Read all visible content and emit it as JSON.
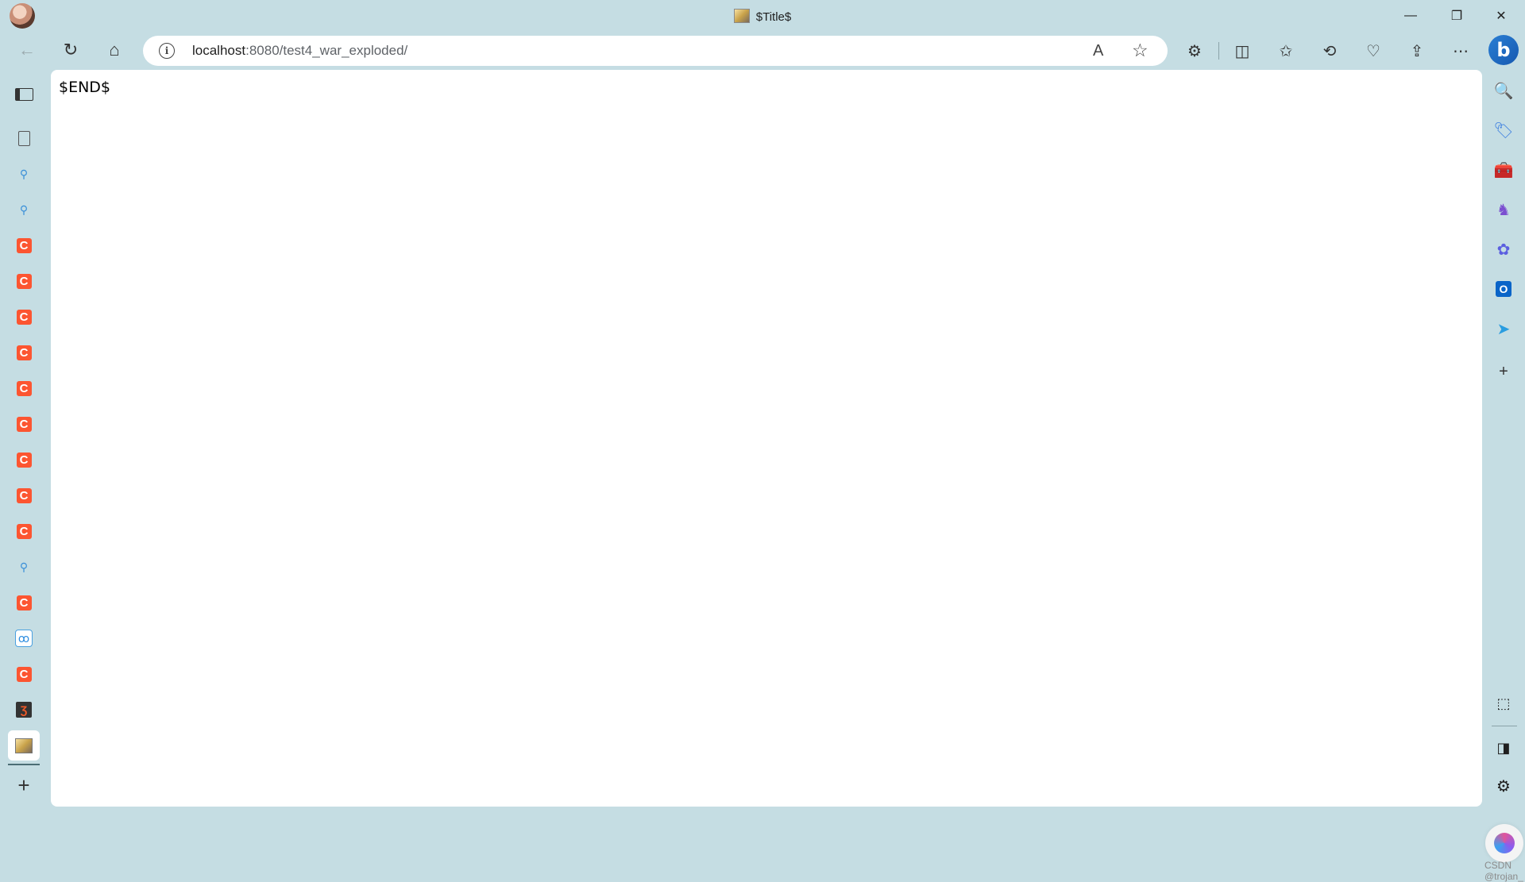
{
  "window": {
    "title": "$Title$",
    "controls": {
      "minimize": "—",
      "restore": "❐",
      "close": "✕"
    }
  },
  "toolbar": {
    "back_icon": "←",
    "reload_icon": "↻",
    "home_icon": "⌂",
    "address": {
      "host": "localhost",
      "rest": ":8080/test4_war_exploded/"
    },
    "read_aloud_icon": "A",
    "favorite_icon": "☆",
    "extensions_icon": "⚙",
    "split_icon": "◫",
    "favorites_icon": "✩",
    "history_icon": "⟲",
    "performance_icon": "♡",
    "share_icon": "⇪",
    "more_icon": "⋯",
    "copilot_label": "b"
  },
  "left_tabs": {
    "new_tab_icon": "+",
    "items": [
      {
        "type": "doc",
        "glyph": ""
      },
      {
        "type": "search",
        "glyph": "⚲"
      },
      {
        "type": "search",
        "glyph": "⚲"
      },
      {
        "type": "csdn",
        "glyph": "C"
      },
      {
        "type": "csdn",
        "glyph": "C"
      },
      {
        "type": "csdn",
        "glyph": "C"
      },
      {
        "type": "csdn",
        "glyph": "C"
      },
      {
        "type": "csdn",
        "glyph": "C"
      },
      {
        "type": "csdn",
        "glyph": "C"
      },
      {
        "type": "csdn",
        "glyph": "C"
      },
      {
        "type": "csdn",
        "glyph": "C"
      },
      {
        "type": "csdn",
        "glyph": "C"
      },
      {
        "type": "search",
        "glyph": "⚲"
      },
      {
        "type": "csdn",
        "glyph": "C"
      },
      {
        "type": "cloud",
        "glyph": "ꝏ"
      },
      {
        "type": "csdn",
        "glyph": "C"
      },
      {
        "type": "rnote",
        "glyph": "Ʒ"
      },
      {
        "type": "image",
        "glyph": ""
      }
    ]
  },
  "page": {
    "body_text": "$END$",
    "watermark": "CSDN @trojan_"
  },
  "right_sidebar": {
    "items": [
      {
        "name": "search-icon",
        "glyph": "🔍",
        "color": "#2f6fd6"
      },
      {
        "name": "shopping-tag-icon",
        "glyph": "🏷",
        "color": "#3a7de0"
      },
      {
        "name": "tools-icon",
        "glyph": "🧰",
        "color": "#d9532b"
      },
      {
        "name": "games-icon",
        "glyph": "♞",
        "color": "#7b4fd0"
      },
      {
        "name": "copilot-apps-icon",
        "glyph": "✿",
        "color": "#5b5fe0"
      },
      {
        "name": "outlook-icon",
        "glyph": "O",
        "color": "#0a64c8"
      },
      {
        "name": "send-icon",
        "glyph": "➤",
        "color": "#2a9de0"
      },
      {
        "name": "add-icon",
        "glyph": "+",
        "color": "#333333"
      }
    ],
    "bottom": {
      "screenshot_icon": "⬚",
      "sidebar_toggle_icon": "◨",
      "settings_icon": "⚙"
    }
  },
  "colors": {
    "frame": "#c5dde3",
    "csdn_orange": "#fc5531",
    "page_bg": "#ffffff"
  }
}
